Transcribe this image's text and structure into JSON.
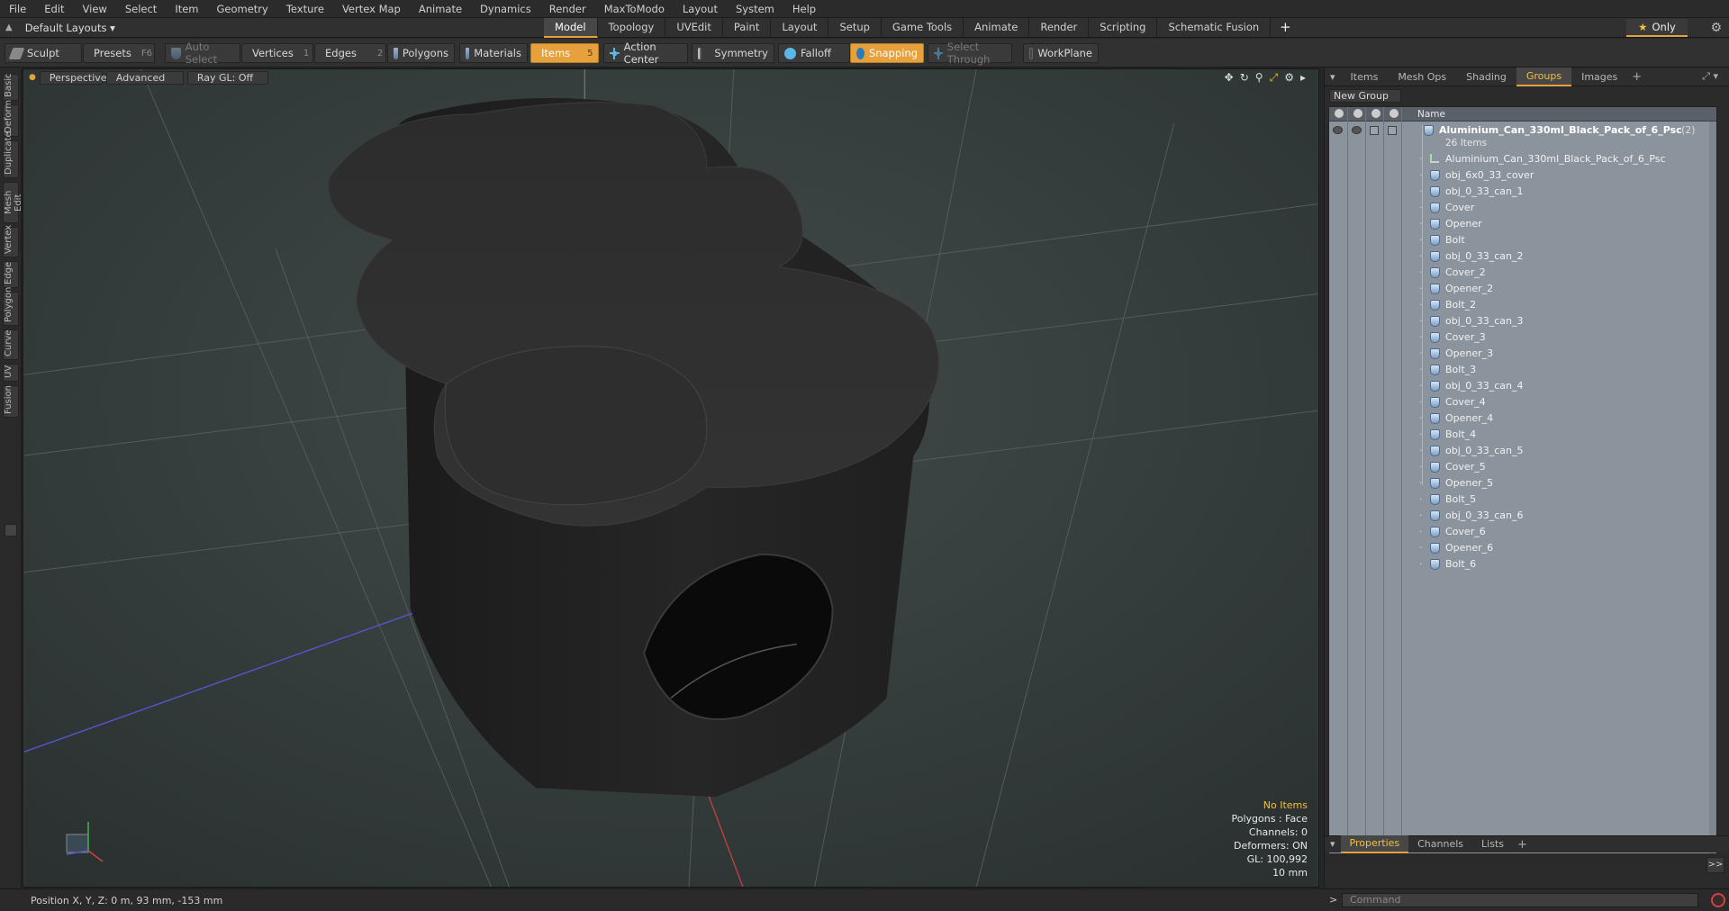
{
  "menu": [
    "File",
    "Edit",
    "View",
    "Select",
    "Item",
    "Geometry",
    "Texture",
    "Vertex Map",
    "Animate",
    "Dynamics",
    "Render",
    "MaxToModo",
    "Layout",
    "System",
    "Help"
  ],
  "layout": {
    "selector": "Default Layouts ▾",
    "tabs": [
      "Model",
      "Topology",
      "UVEdit",
      "Paint",
      "Layout",
      "Setup",
      "Game Tools",
      "Animate",
      "Render",
      "Scripting",
      "Schematic Fusion"
    ],
    "active_tab": "Model",
    "plus": "+",
    "only_label": "Only"
  },
  "toolbar": {
    "sculpt": "Sculpt",
    "presets": "Presets",
    "presets_key": "F6",
    "auto_select": "Auto Select",
    "vertices": "Vertices",
    "vertices_key": "1",
    "edges": "Edges",
    "edges_key": "2",
    "polygons": "Polygons",
    "materials": "Materials",
    "items": "Items",
    "items_key": "5",
    "action_center": "Action Center",
    "symmetry": "Symmetry",
    "falloff": "Falloff",
    "snapping": "Snapping",
    "select_through": "Select Through",
    "workplane": "WorkPlane"
  },
  "left_tabs": [
    "Basic",
    "Deform",
    "Duplicate",
    "Mesh Edit",
    "Vertex",
    "Edge",
    "Polygon",
    "Curve",
    "UV",
    "Fusion"
  ],
  "viewport": {
    "view": "Perspective",
    "mode": "Advanced",
    "raygl": "Ray GL: Off",
    "info": {
      "items": "No Items",
      "polygons": "Polygons : Face",
      "channels": "Channels: 0",
      "deformers": "Deformers: ON",
      "gl": "GL: 100,992",
      "scale": "10 mm"
    },
    "colors": {
      "bg": "#3a4040",
      "mesh": "#262626",
      "accent": "#e6a03c"
    }
  },
  "status": {
    "position": "Position X, Y, Z:  0 m, 93 mm, -153 mm"
  },
  "right_panel": {
    "tabs": [
      "Items",
      "Mesh Ops",
      "Shading",
      "Groups",
      "Images"
    ],
    "active_tab": "Groups",
    "new_group": "New Group",
    "column_name": "Name",
    "root": {
      "name": "Aluminium_Can_330ml_Black_Pack_of_6_Psc",
      "count": "(2)",
      "sub": "26 Items"
    },
    "children": [
      "Aluminium_Can_330ml_Black_Pack_of_6_Psc",
      "obj_6x0_33_cover",
      "obj_0_33_can_1",
      "Cover",
      "Opener",
      "Bolt",
      "obj_0_33_can_2",
      "Cover_2",
      "Opener_2",
      "Bolt_2",
      "obj_0_33_can_3",
      "Cover_3",
      "Opener_3",
      "Bolt_3",
      "obj_0_33_can_4",
      "Cover_4",
      "Opener_4",
      "Bolt_4",
      "obj_0_33_can_5",
      "Cover_5",
      "Opener_5",
      "Bolt_5",
      "obj_0_33_can_6",
      "Cover_6",
      "Opener_6",
      "Bolt_6"
    ],
    "bottom_tabs": [
      "Properties",
      "Channels",
      "Lists"
    ],
    "bottom_active": "Properties",
    "expand": ">>"
  },
  "command": {
    "prompt": ">",
    "placeholder": "Command"
  }
}
